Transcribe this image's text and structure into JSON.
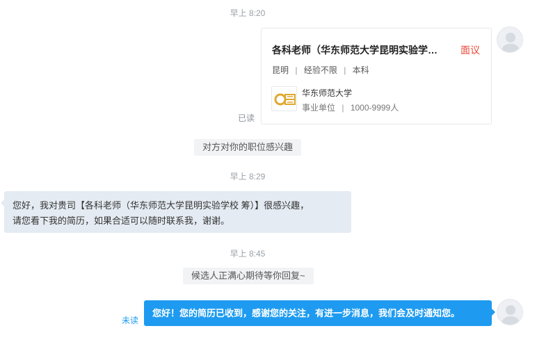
{
  "colors": {
    "accent": "#1e9bf0",
    "interview_tag": "#e64a3b",
    "incoming_bubble": "#e4ebf2",
    "system_bg": "#f1f3f5"
  },
  "messages": {
    "time1": "早上 8:20",
    "job_card": {
      "title": "各科老师（华东师范大学昆明实验学…",
      "tag": "面议",
      "city": "昆明",
      "experience": "经验不限",
      "education": "本科",
      "sep": "|",
      "org_name": "华东师范大学",
      "org_type": "事业单位",
      "org_size": "1000-9999人",
      "logo_icon": "university-logo-icon"
    },
    "read_status": "已读",
    "system1": "对方对你的职位感兴趣",
    "time2": "早上 8:29",
    "incoming_line1": "您好，我对贵司【各科老师（华东师范大学昆明实验学校 筹）】很感兴趣，",
    "incoming_line2": "请您看下我的简历，如果合适可以随时联系我，谢谢。",
    "time3": "早上 8:45",
    "system2": "候选人正满心期待等你回复~",
    "unread_status": "未读",
    "outgoing": "您好！您的简历已收到，感谢您的关注，有进一步消息，我们会及时通知您。"
  }
}
